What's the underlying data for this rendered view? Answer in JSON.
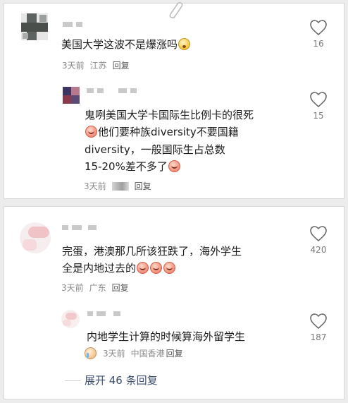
{
  "clip_icon": "paperclip-icon",
  "like_icon": "heart-outline-icon",
  "comments": [
    {
      "text_lines": [
        "美国大学这波不是爆涨吗"
      ],
      "emoji_end": "yellow-face-emoji",
      "time": "3天前",
      "location": "江苏",
      "reply_label": "回复",
      "likes": "16",
      "replies": [
        {
          "text_lines": [
            "鬼咧美国大学卡国际生比例卡的很死",
            "他们要种族diversity不要国籍",
            "diversity，一般国际生占总数",
            "15-20%差不多了"
          ],
          "time": "3天前",
          "reply_label": "回复",
          "likes": "15"
        }
      ]
    },
    {
      "text_lines": [
        "完蛋，港澳那几所该狂跌了，海外学生",
        "全是内地过去的"
      ],
      "time": "3天前",
      "location": "广东",
      "reply_label": "回复",
      "likes": "420",
      "replies": [
        {
          "text_lines": [
            "内地学生计算的时候算海外留学生"
          ],
          "time": "3天前",
          "location": "中国香港",
          "reply_label": "回复",
          "likes": "187"
        }
      ],
      "expand_label": "展开 46 条回复"
    }
  ]
}
